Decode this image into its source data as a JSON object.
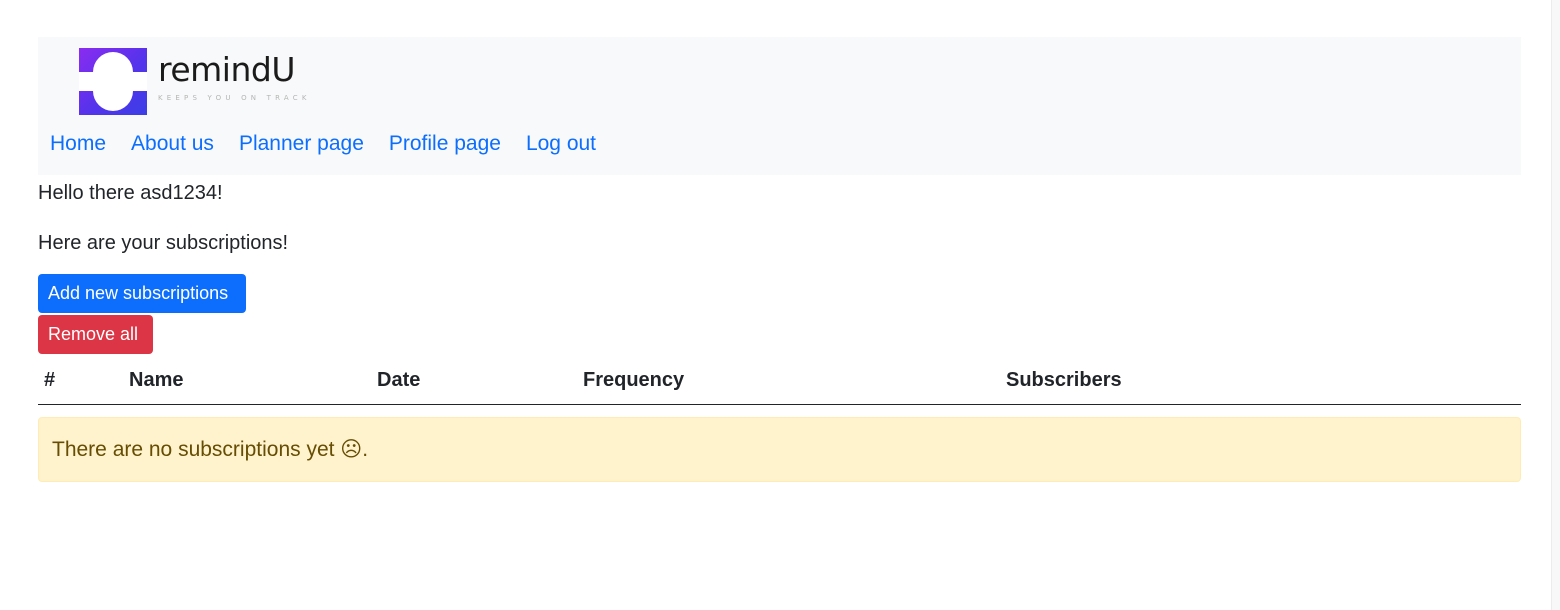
{
  "brand": {
    "name": "remindU",
    "tagline": "KEEPS YOU ON TRACK",
    "logo_icon": "remindu-logo-icon",
    "logo_colors": [
      "#8a2cf0",
      "#3b3ee6"
    ]
  },
  "nav": {
    "items": [
      {
        "label": "Home"
      },
      {
        "label": "About us"
      },
      {
        "label": "Planner page"
      },
      {
        "label": "Profile page"
      },
      {
        "label": "Log out"
      }
    ]
  },
  "main": {
    "greeting": "Hello there asd1234!",
    "intro": "Here are your subscriptions!",
    "add_button": "Add new subscriptions",
    "remove_button": "Remove all"
  },
  "table": {
    "headers": [
      "#",
      "Name",
      "Date",
      "Frequency",
      "Subscribers"
    ]
  },
  "alert": {
    "message": "There are no subscriptions yet ☹."
  },
  "colors": {
    "primary": "#0d6efd",
    "danger": "#dc3545",
    "navbar_bg": "#f8f9fa",
    "alert_bg": "#fff3cd",
    "alert_text": "#664d03"
  }
}
